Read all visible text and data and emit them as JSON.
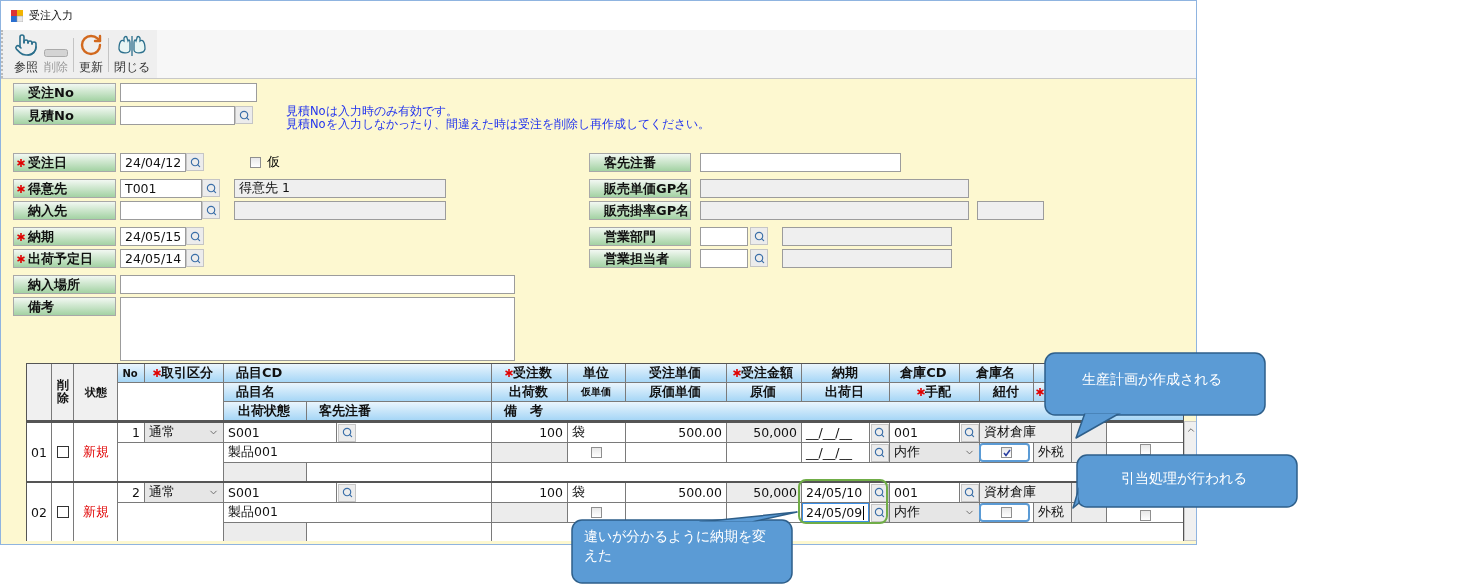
{
  "window": {
    "title": "受注入力"
  },
  "toolbar": [
    {
      "kind": "hand",
      "label": "参照",
      "disabled": false
    },
    {
      "kind": "minus",
      "label": "削除",
      "disabled": true
    },
    {
      "kind": "refresh",
      "label": "更新",
      "disabled": false
    },
    {
      "kind": "close",
      "label": "閉じる",
      "disabled": false
    }
  ],
  "top_fields": [
    {
      "label": "受注No",
      "kind": "plain"
    },
    {
      "label": "見積No",
      "kind": "lookup"
    }
  ],
  "notice": [
    "見積Noは入力時のみ有効です。",
    "見積Noを入力しなかったり、間違えた時は受注を削除し再作成してください。"
  ],
  "left_groups": [
    [
      {
        "label": "受注日",
        "required": true,
        "kind": "date",
        "value": "24/04/12",
        "flag": {
          "label": "仮",
          "checked": false
        }
      }
    ],
    [
      {
        "label": "得意先",
        "required": true,
        "kind": "code",
        "value": "T001",
        "name": "得意先 1"
      },
      {
        "label": "納入先",
        "required": false,
        "kind": "code"
      }
    ],
    [
      {
        "label": "納期",
        "required": true,
        "kind": "date",
        "value": "24/05/15"
      },
      {
        "label": "出荷予定日",
        "required": true,
        "kind": "date",
        "value": "24/05/14"
      }
    ],
    [
      {
        "label": "納入場所",
        "required": false,
        "kind": "text"
      },
      {
        "label": "備考",
        "required": false,
        "kind": "memo"
      }
    ]
  ],
  "right_groups": [
    [
      {
        "label": "客先注番",
        "kind": "order_ref"
      }
    ],
    [
      {
        "label": "販売単価GP名",
        "kind": "readonly"
      },
      {
        "label": "販売掛率GP名",
        "kind": "readonly_pair"
      }
    ],
    [
      {
        "label": "営業部門",
        "kind": "short_code"
      },
      {
        "label": "営業担当者",
        "kind": "short_code"
      }
    ]
  ],
  "grid": {
    "fixed_headers": [
      {
        "label": "削除"
      },
      {
        "label": "状態"
      }
    ],
    "header_rows": [
      [
        {
          "label": "No"
        },
        {
          "label": "取引区分",
          "required": true
        },
        {
          "label": "品目CD"
        },
        {
          "label": "受注数",
          "required": true
        },
        {
          "label": "単位"
        },
        {
          "label": "受注単価"
        },
        {
          "label": "受注金額",
          "required": true
        },
        {
          "label": "納期"
        },
        {
          "label": "倉庫CD"
        },
        {
          "label": "倉庫名"
        }
      ],
      [
        {
          "label": "品目名"
        },
        {
          "label": "出荷数"
        },
        {
          "label": "仮単価"
        },
        {
          "label": "原価単価"
        },
        {
          "label": "原価"
        },
        {
          "label": "出荷日"
        },
        {
          "label": "手配",
          "required": true
        },
        {
          "label": "紐付"
        },
        {
          "required": true
        }
      ],
      [
        {
          "label": "出荷状態"
        },
        {
          "label": "客先注番"
        },
        {
          "label": "備　考"
        }
      ]
    ],
    "rows": [
      {
        "row_no": "01",
        "deleted": false,
        "status": "新規",
        "no": "1",
        "category": "通常",
        "item_cd": "S001",
        "qty": "100",
        "unit": "袋",
        "unit_price": "500.00",
        "amount": "50,000",
        "due_date": "__/__/__",
        "warehouse_cd": "001",
        "warehouse_name": "資材倉庫",
        "item_name": "製品001",
        "provisional_price": false,
        "ship_date": "__/__/__",
        "ship_date_focused": false,
        "arrangement": "内作",
        "linked": true,
        "tax": "外税",
        "extra_checked": false
      },
      {
        "row_no": "02",
        "deleted": false,
        "status": "新規",
        "no": "2",
        "category": "通常",
        "item_cd": "S001",
        "qty": "100",
        "unit": "袋",
        "unit_price": "500.00",
        "amount": "50,000",
        "due_date": "24/05/10",
        "warehouse_cd": "001",
        "warehouse_name": "資材倉庫",
        "item_name": "製品001",
        "provisional_price": false,
        "ship_date": "24/05/09",
        "ship_date_focused": true,
        "arrangement": "内作",
        "linked": false,
        "tax": "外税",
        "extra_checked": false
      }
    ]
  },
  "highlights": [
    {
      "color": "#70ad47"
    },
    {
      "color": "#5b9bd5"
    },
    {
      "color": "#5b9bd5"
    }
  ],
  "callouts": [
    {
      "text": "生産計画が作成される"
    },
    {
      "text": "引当処理が行われる"
    },
    {
      "text": "違いが分かるように納期を変えた"
    }
  ]
}
